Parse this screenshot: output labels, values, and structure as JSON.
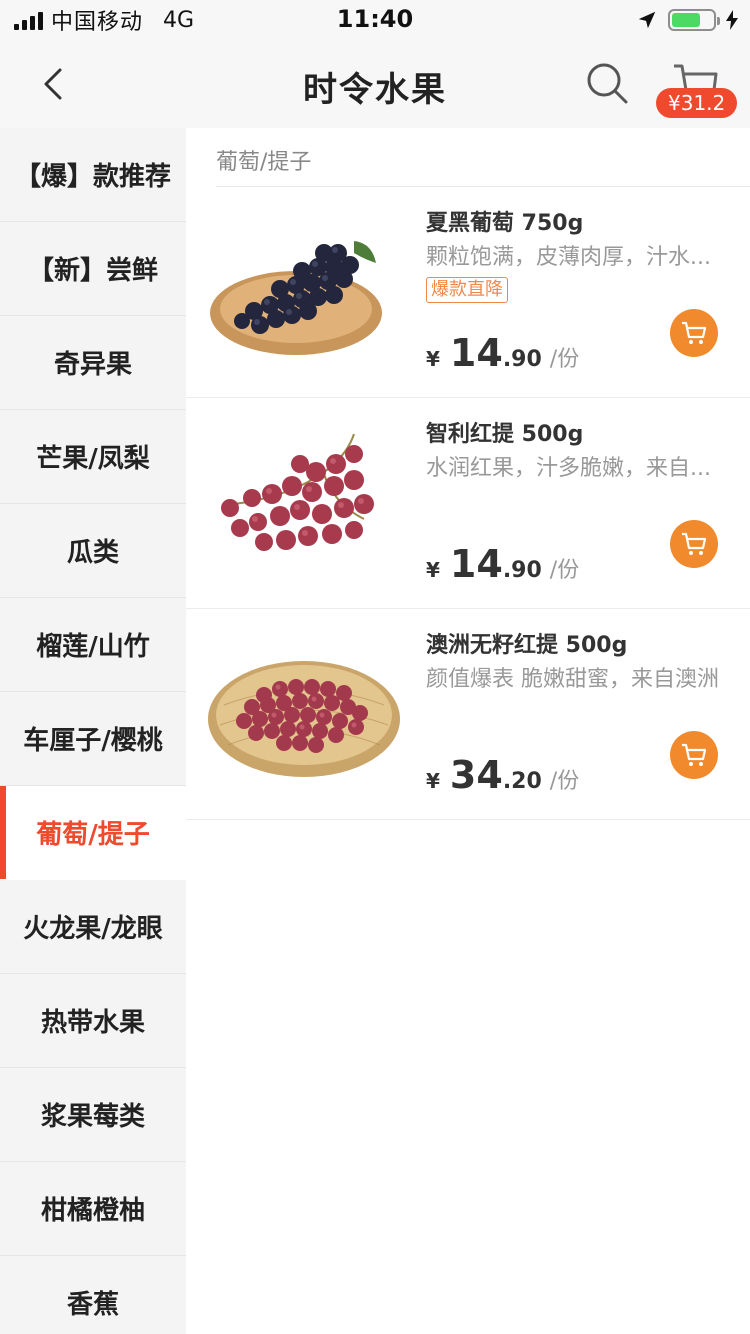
{
  "status_bar": {
    "carrier": "中国移动",
    "network": "4G",
    "time": "11:40"
  },
  "nav": {
    "title": "时令水果",
    "cart_total": "¥31.2"
  },
  "sidebar": {
    "items": [
      {
        "label": "【爆】款推荐"
      },
      {
        "label": "【新】尝鲜"
      },
      {
        "label": "奇异果"
      },
      {
        "label": "芒果/凤梨"
      },
      {
        "label": "瓜类"
      },
      {
        "label": "榴莲/山竹"
      },
      {
        "label": "车厘子/樱桃"
      },
      {
        "label": "葡萄/提子"
      },
      {
        "label": "火龙果/龙眼"
      },
      {
        "label": "热带水果"
      },
      {
        "label": "浆果莓类"
      },
      {
        "label": "柑橘橙柚"
      },
      {
        "label": "香蕉"
      }
    ],
    "active_index": 7
  },
  "section": {
    "title": "葡萄/提子"
  },
  "products": [
    {
      "name": "夏黑葡萄 750g",
      "desc": "颗粒饱满，皮薄肉厚，汁水...",
      "tag": "爆款直降",
      "currency": "¥",
      "price_int": "14",
      "price_dec": ".90",
      "unit": "/份"
    },
    {
      "name": "智利红提 500g",
      "desc": "水润红果，汁多脆嫩，来自...",
      "currency": "¥",
      "price_int": "14",
      "price_dec": ".90",
      "unit": "/份"
    },
    {
      "name": "澳洲无籽红提 500g",
      "desc": "颜值爆表 脆嫩甜蜜，来自澳洲",
      "currency": "¥",
      "price_int": "34",
      "price_dec": ".20",
      "unit": "/份"
    }
  ],
  "colors": {
    "accent": "#ef4a2e",
    "cart_button": "#f08a2c",
    "tag": "#f0884b"
  }
}
